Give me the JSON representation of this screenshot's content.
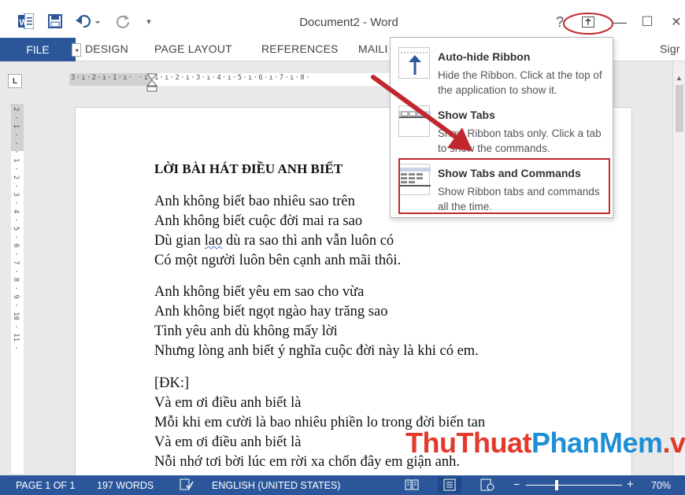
{
  "window": {
    "title": "Document2 - Word",
    "help": "?",
    "minimize": "—",
    "maximize": "☐",
    "close": "✕"
  },
  "ribbon": {
    "file_tab": "FILE",
    "tabs": [
      "DESIGN",
      "PAGE LAYOUT",
      "REFERENCES",
      "MAILI"
    ],
    "signin": "Sigr"
  },
  "ruler": {
    "corner": "L",
    "horizontal": "3·ı·2·ı·1·ı· ·ı·1·ı·2·ı·3·ı·4·ı·5·ı·6·ı·7·ı·8·",
    "vertical": "2 · 1 · · · 1 · 2 · 3 · 4 · 5 · 6 · 7 · 8 · 9 · 10 · 11 ·"
  },
  "document": {
    "title": "LỜI BÀI HÁT ĐIỀU ANH BIẾT",
    "stanza1": [
      "Anh không biết bao nhiêu sao trên",
      "Anh không biết cuộc đời mai ra sao",
      "Dù gian lao dù ra sao thì anh vẫn luôn có",
      "Có một người luôn bên cạnh anh mãi thôi."
    ],
    "stanza1_line3_pre": "Dù gian ",
    "stanza1_line3_sq": "lao",
    "stanza1_line3_post": " dù ra sao thì anh vẫn luôn có",
    "stanza2": [
      "Anh không biết yêu em sao cho vừa",
      "Anh không biết ngọt ngào hay trăng sao",
      "Tình yêu anh dù không mấy lời",
      "Nhưng lòng anh biết ý nghĩa cuộc đời này là khi có em."
    ],
    "stanza3": [
      "[ĐK:]",
      "Và em ơi điều anh biết là",
      "Mỗi khi em cười là bao nhiêu phiền lo trong đời biến tan",
      "Và em ơi điều anh biết là",
      "Nỗi nhớ tơi bời lúc em rời xa chốn đây em giận anh."
    ]
  },
  "menu": {
    "items": [
      {
        "title": "Auto-hide Ribbon",
        "desc": "Hide the Ribbon. Click at the top of the application to show it."
      },
      {
        "title": "Show Tabs",
        "desc": "Show Ribbon tabs only. Click a tab to show the commands."
      },
      {
        "title": "Show Tabs and Commands",
        "desc": "Show Ribbon tabs and commands all the time."
      }
    ]
  },
  "status": {
    "page": "PAGE 1 OF 1",
    "words": "197 WORDS",
    "language": "ENGLISH (UNITED STATES)",
    "zoom_minus": "−",
    "zoom_plus": "+",
    "zoom": "70%"
  },
  "watermark": {
    "part1": "ThuThuat",
    "part2": "PhanMem",
    "part3": ".vn"
  },
  "colors": {
    "accent": "#2b579a",
    "highlight": "#c0282d",
    "arrow": "#c0282d"
  }
}
